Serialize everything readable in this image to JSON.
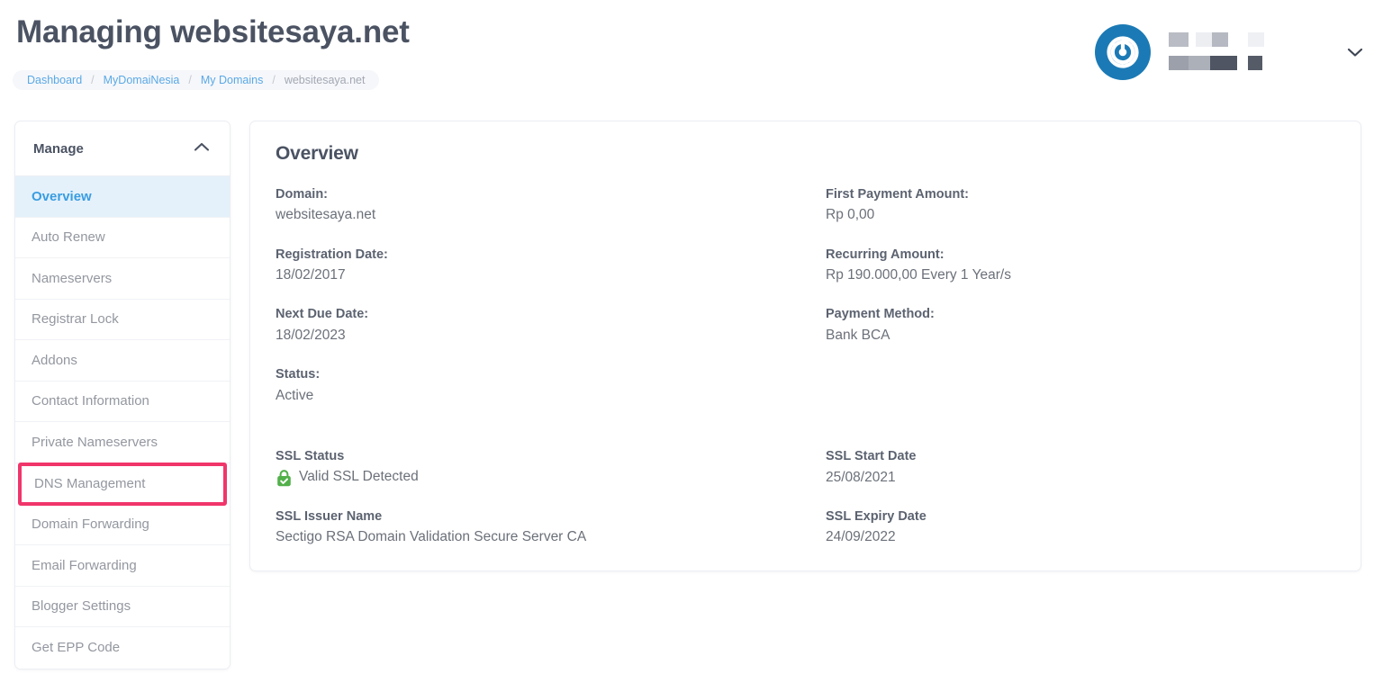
{
  "header": {
    "title": "Managing websitesaya.net",
    "breadcrumb": [
      {
        "label": "Dashboard",
        "current": false
      },
      {
        "label": "MyDomaiNesia",
        "current": false
      },
      {
        "label": "My Domains",
        "current": false
      },
      {
        "label": "websitesaya.net",
        "current": true
      }
    ],
    "separator": "/",
    "avatar_icon": "spiral-logo-icon",
    "user_name": "",
    "dropdown_icon": "chevron-down-icon"
  },
  "sidebar": {
    "title": "Manage",
    "collapse_icon": "chevron-up-icon",
    "items": [
      {
        "label": "Overview",
        "active": true,
        "highlighted": false
      },
      {
        "label": "Auto Renew",
        "active": false,
        "highlighted": false
      },
      {
        "label": "Nameservers",
        "active": false,
        "highlighted": false
      },
      {
        "label": "Registrar Lock",
        "active": false,
        "highlighted": false
      },
      {
        "label": "Addons",
        "active": false,
        "highlighted": false
      },
      {
        "label": "Contact Information",
        "active": false,
        "highlighted": false
      },
      {
        "label": "Private Nameservers",
        "active": false,
        "highlighted": false
      },
      {
        "label": "DNS Management",
        "active": false,
        "highlighted": true
      },
      {
        "label": "Domain Forwarding",
        "active": false,
        "highlighted": false
      },
      {
        "label": "Email Forwarding",
        "active": false,
        "highlighted": false
      },
      {
        "label": "Blogger Settings",
        "active": false,
        "highlighted": false
      },
      {
        "label": "Get EPP Code",
        "active": false,
        "highlighted": false
      }
    ]
  },
  "panel": {
    "title": "Overview",
    "left_fields": [
      {
        "label": "Domain:",
        "value": "websitesaya.net"
      },
      {
        "label": "Registration Date:",
        "value": "18/02/2017"
      },
      {
        "label": "Next Due Date:",
        "value": "18/02/2023"
      },
      {
        "label": "Status:",
        "value": "Active"
      }
    ],
    "right_fields": [
      {
        "label": "First Payment Amount:",
        "value": "Rp 0,00"
      },
      {
        "label": "Recurring Amount:",
        "value": "Rp 190.000,00 Every 1 Year/s"
      },
      {
        "label": "Payment Method:",
        "value": "Bank BCA"
      }
    ],
    "ssl_left": [
      {
        "label": "SSL Status",
        "value": "Valid SSL Detected",
        "icon": "green-lock-check-icon"
      },
      {
        "label": "SSL Issuer Name",
        "value": "Sectigo RSA Domain Validation Secure Server CA",
        "icon": ""
      }
    ],
    "ssl_right": [
      {
        "label": "SSL Start Date",
        "value": "25/08/2021"
      },
      {
        "label": "SSL Expiry Date",
        "value": "24/09/2022"
      }
    ]
  },
  "colors": {
    "accent_blue": "#3a9de0",
    "active_bg": "#e4f1fb",
    "highlight_pink": "#f0356a",
    "avatar_blue": "#1b7ab5",
    "ssl_green": "#52b04a",
    "heading": "#4b5363",
    "muted_text": "#93979f"
  }
}
